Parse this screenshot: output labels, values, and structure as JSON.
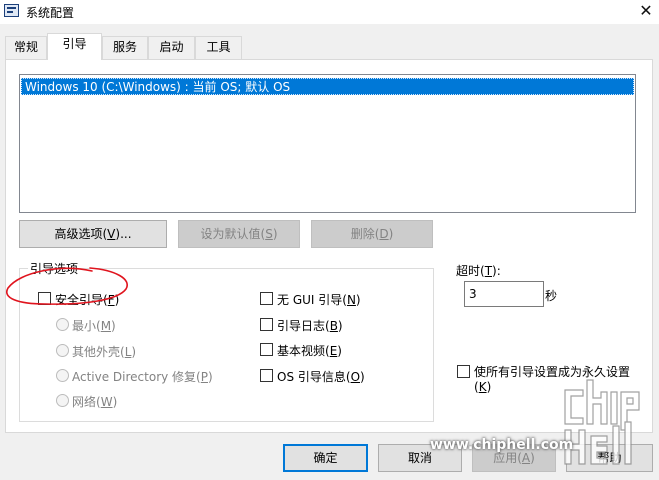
{
  "window": {
    "title": "系统配置",
    "close_glyph": "✕"
  },
  "tabs": [
    {
      "label": "常规"
    },
    {
      "label": "引导"
    },
    {
      "label": "服务"
    },
    {
      "label": "启动"
    },
    {
      "label": "工具"
    }
  ],
  "active_tab": "引导",
  "os_list": {
    "items": [
      {
        "label": "Windows 10 (C:\\Windows) : 当前 OS; 默认 OS",
        "selected": true
      }
    ]
  },
  "buttons": {
    "advanced_prefix": "高级选项(",
    "advanced_key": "V",
    "advanced_suffix": ")...",
    "set_default_prefix": "设为默认值(",
    "set_default_key": "S",
    "set_default_suffix": ")",
    "delete_prefix": "删除(",
    "delete_key": "D",
    "delete_suffix": ")"
  },
  "boot_options": {
    "group_label": "引导选项",
    "safe_boot": {
      "prefix": "安全引导(",
      "key": "F",
      "suffix": ")",
      "checked": false
    },
    "minimal": {
      "prefix": "最小(",
      "key": "M",
      "suffix": ")"
    },
    "alternate_shell": {
      "prefix": "其他外壳(",
      "key": "L",
      "suffix": ")"
    },
    "active_directory": {
      "prefix": "Active Directory 修复(",
      "key": "P",
      "suffix": ")"
    },
    "network": {
      "prefix": "网络(",
      "key": "W",
      "suffix": ")"
    },
    "no_gui": {
      "prefix": "无 GUI 引导(",
      "key": "N",
      "suffix": ")",
      "checked": false
    },
    "boot_log": {
      "prefix": "引导日志(",
      "key": "B",
      "suffix": ")",
      "checked": false
    },
    "base_video": {
      "prefix": "基本视频(",
      "key": "E",
      "suffix": ")",
      "checked": false
    },
    "os_boot_info": {
      "prefix": "OS 引导信息(",
      "key": "O",
      "suffix": ")",
      "checked": false
    }
  },
  "timeout": {
    "label_prefix": "超时(",
    "label_key": "T",
    "label_suffix": "):",
    "value": "3",
    "unit": "秒"
  },
  "permanent": {
    "line1": "使所有引导设置成为永久设置",
    "line2_prefix": "(",
    "line2_key": "K",
    "line2_suffix": ")",
    "checked": false
  },
  "footer": {
    "ok": "确定",
    "cancel": "取消",
    "apply_prefix": "应用(",
    "apply_key": "A",
    "apply_suffix": ")",
    "help": "帮助"
  },
  "watermark": {
    "text": "www.chiphell.com"
  },
  "colors": {
    "selection": "#0078d7",
    "annotation": "#e0141e",
    "window_bg": "#f0f0f0"
  }
}
